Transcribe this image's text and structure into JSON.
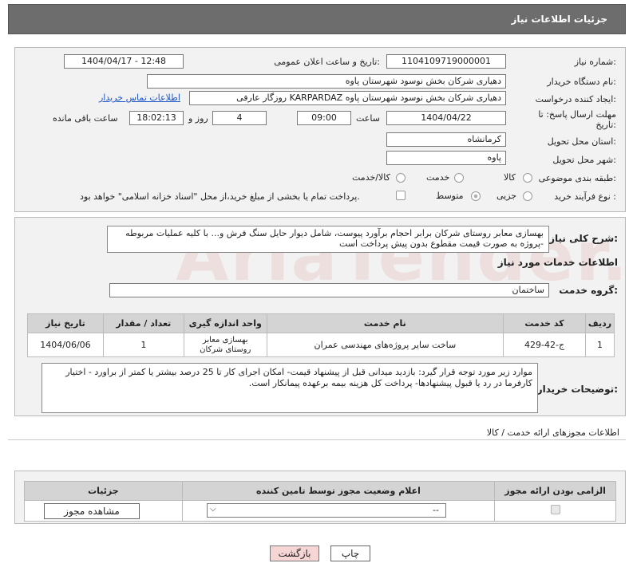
{
  "header": {
    "title": "جزئیات اطلاعات نیاز"
  },
  "watermark": {
    "text": "AriaTender.net"
  },
  "fields": {
    "need_number_label": "شماره نیاز:",
    "need_number": "1104109719000001",
    "announce_label": "تاریخ و ساعت اعلان عمومی:",
    "announce_value": "1404/04/17 - 12:48",
    "buyer_label": "نام دستگاه خریدار:",
    "buyer_value": "دهیاری شرکان بخش نوسود شهرستان پاوه",
    "creator_label": "ایجاد کننده درخواست:",
    "creator_value": "روزگار عارفی KARPARDAZ دهیاری شرکان بخش نوسود شهرستان پاوه",
    "contact_link": "اطلاعات تماس خریدار",
    "deadline_label": "مهلت ارسال پاسخ: تا تاریخ:",
    "deadline_date": "1404/04/22",
    "time_label": "ساعت",
    "deadline_time": "09:00",
    "days_value": "4",
    "days_label": "روز و",
    "remaining_time": "18:02:13",
    "remaining_label": "ساعت باقی مانده",
    "province_label": "استان محل تحویل:",
    "province_value": "کرمانشاه",
    "city_label": "شهر محل تحویل:",
    "city_value": "پاوه",
    "category_label": "طبقه بندی موضوعی:",
    "category_options": [
      "کالا",
      "خدمت",
      "کالا/خدمت"
    ],
    "purchase_label": "نوع فرآیند خرید :",
    "purchase_options": [
      "جزیی",
      "متوسط"
    ],
    "treasury_note": "پرداخت تمام یا بخشی از مبلغ خرید،از محل \"اسناد خزانه اسلامی\" خواهد بود."
  },
  "summary": {
    "label": "شرح کلی نیاز:",
    "text": "بهسازی معابر روستای شرکان برابر احجام برآورد پیوست، شامل دیوار حایل سنگ فرش و... با کلیه عملیات مربوطه -پروژه به صورت قیمت مقطوع بدون پیش پرداخت است"
  },
  "services": {
    "section_title": "اطلاعات خدمات مورد نیاز",
    "group_label": "گروه خدمت:",
    "group_value": "ساختمان",
    "columns": [
      "ردیف",
      "کد خدمت",
      "نام خدمت",
      "واحد اندازه گیری",
      "تعداد / مقدار",
      "تاریخ نیاز"
    ],
    "rows": [
      {
        "row": "1",
        "code": "ج-42-429",
        "name": "ساخت سایر پروژه‌های مهندسی عمران",
        "unit": "بهسازی معابر روستای شرکان",
        "qty": "1",
        "date": "1404/06/06"
      }
    ]
  },
  "buyer_notes": {
    "label": "توضیحات خریدار:",
    "text": "موارد زیر مورد توجه قرار گیرد: بازدید میدانی قبل از پیشنهاد قیمت- امکان اجرای کار تا 25 درصد بیشتر یا کمتر از براورد - اختیار کارفرما در رد یا قبول پیشنهادها- پرداخت کل هزینه بیمه برعهده پیمانکار است."
  },
  "permits": {
    "title": "اطلاعات مجوزهای ارائه خدمت / کالا",
    "columns": [
      "الزامی بودن ارائه مجوز",
      "اعلام وضعیت مجوز توسط تامین کننده",
      "جزئیات"
    ],
    "select_value": "--",
    "view_button": "مشاهده مجوز"
  },
  "buttons": {
    "print": "چاپ",
    "back": "بازگشت"
  }
}
